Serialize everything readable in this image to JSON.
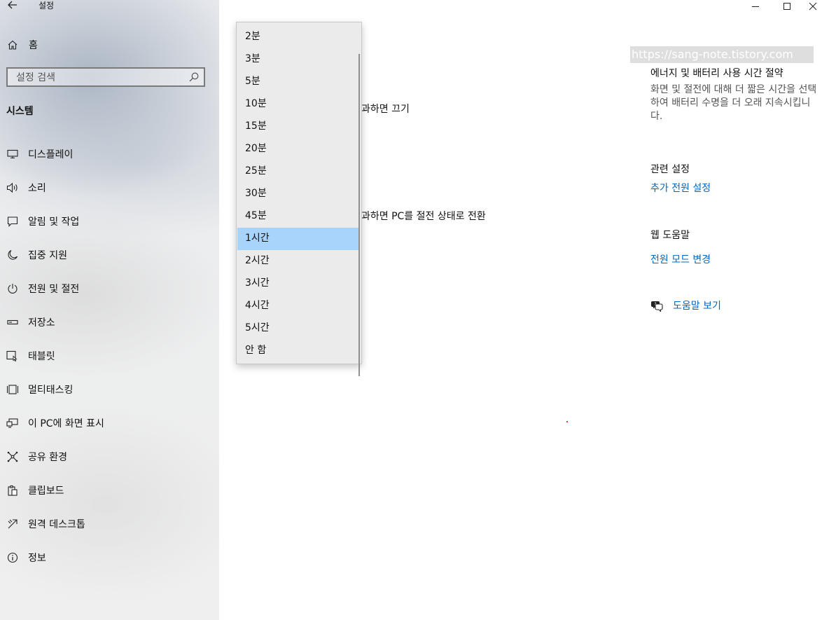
{
  "app": {
    "title": "설정",
    "back_icon": "back-arrow-icon"
  },
  "sidebar": {
    "home_label": "홈",
    "search_placeholder": "설정 검색",
    "section_title": "시스템",
    "items": [
      {
        "label": "디스플레이",
        "icon": "monitor-icon"
      },
      {
        "label": "소리",
        "icon": "speaker-icon"
      },
      {
        "label": "알림 및 작업",
        "icon": "notification-icon"
      },
      {
        "label": "집중 지원",
        "icon": "moon-icon"
      },
      {
        "label": "전원 및 절전",
        "icon": "power-icon"
      },
      {
        "label": "저장소",
        "icon": "storage-icon"
      },
      {
        "label": "태블릿",
        "icon": "tablet-icon"
      },
      {
        "label": "멀티태스킹",
        "icon": "multitasking-icon"
      },
      {
        "label": "이 PC에 화면 표시",
        "icon": "project-icon"
      },
      {
        "label": "공유 환경",
        "icon": "share-icon"
      },
      {
        "label": "클립보드",
        "icon": "clipboard-icon"
      },
      {
        "label": "원격 데스크톱",
        "icon": "remote-desktop-icon"
      },
      {
        "label": "정보",
        "icon": "info-icon"
      }
    ]
  },
  "main": {
    "screen_off_text": "과하면 끄기",
    "sleep_text": "과하면 PC를 절전 상태로 전환"
  },
  "dropdown": {
    "options": [
      "2분",
      "3분",
      "5분",
      "10분",
      "15분",
      "20분",
      "25분",
      "30분",
      "45분",
      "1시간",
      "2시간",
      "3시간",
      "4시간",
      "5시간",
      "안 함"
    ],
    "selected": "1시간"
  },
  "right_column": {
    "watermark": "https://sang-note.tistory.com",
    "energy_title": "에너지 및 배터리 사용 시간 절약",
    "energy_desc": "화면 및 절전에 대해 더 짧은 시간을 선택하여 배터리 수명을 더 오래 지속시킵니다.",
    "related_title": "관련 설정",
    "related_link": "추가 전원 설정",
    "web_help_title": "웹 도움말",
    "web_help_link": "전원 모드 변경",
    "get_help_label": "도움말 보기",
    "get_help_icon": "help-chat-icon"
  },
  "colors": {
    "link": "#0067c0",
    "selected_option": "#a8d4fb"
  }
}
